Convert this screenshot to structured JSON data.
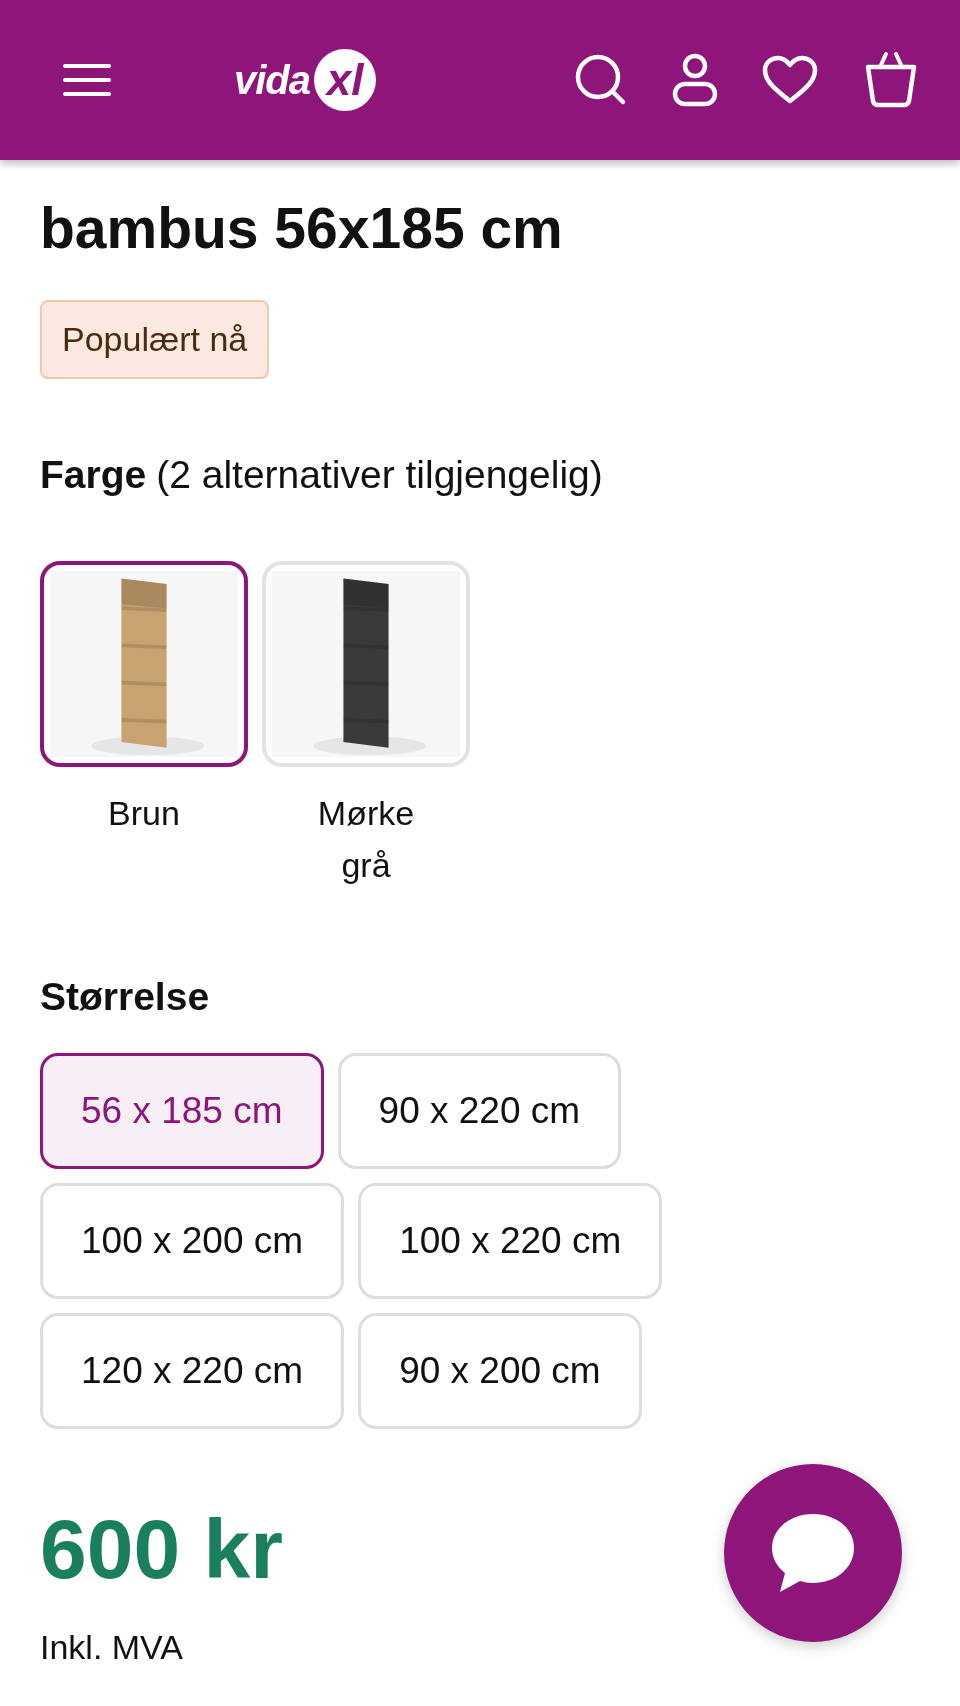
{
  "header": {
    "logo": {
      "word": "vida",
      "mark": "xl"
    }
  },
  "product": {
    "title_line": "bambus 56x185 cm",
    "badge": "Populært nå"
  },
  "color_option": {
    "label": "Farge",
    "note": "(2 alternativer tilgjengelig)",
    "swatches": [
      {
        "name": "Brun",
        "color": "#c9a271",
        "selected": true
      },
      {
        "name": "Mørke grå",
        "color": "#3a3a3a",
        "selected": false
      }
    ]
  },
  "size_option": {
    "label": "Størrelse",
    "sizes": [
      {
        "label": "56 x 185 cm",
        "selected": true
      },
      {
        "label": "90 x 220 cm",
        "selected": false
      },
      {
        "label": "100 x 200 cm",
        "selected": false
      },
      {
        "label": "100 x 220 cm",
        "selected": false
      },
      {
        "label": "120 x 220 cm",
        "selected": false
      },
      {
        "label": "90 x 200 cm",
        "selected": false
      }
    ]
  },
  "price": {
    "amount": "600 kr",
    "tax_note": "Inkl. MVA"
  }
}
